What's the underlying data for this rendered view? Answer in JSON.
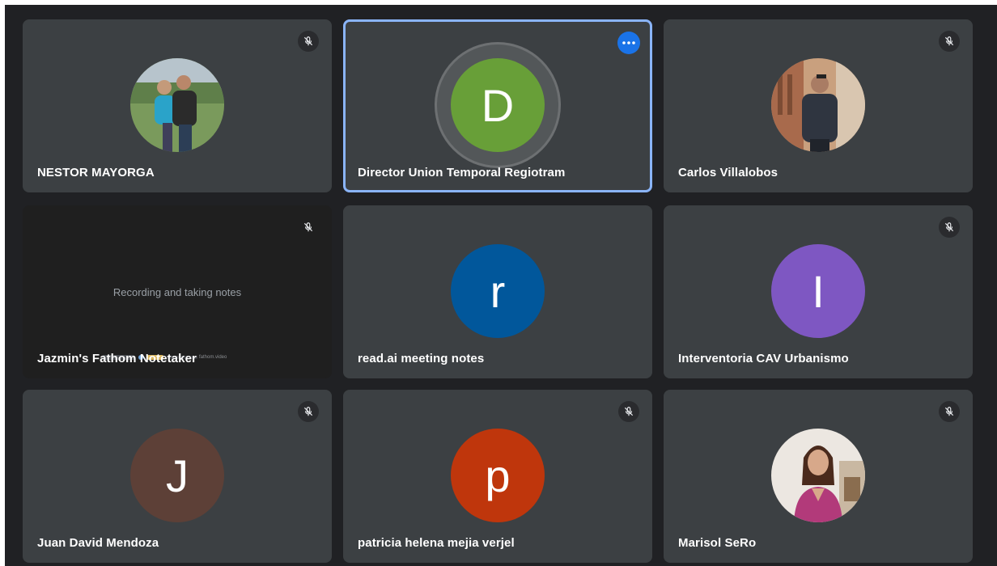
{
  "participants": [
    {
      "name": "NESTOR MAYORGA",
      "avatar": "photo",
      "muted": true
    },
    {
      "name": "Director Union Temporal Regiotram",
      "initial": "D",
      "color": "#689f38",
      "speaking": true
    },
    {
      "name": "Carlos Villalobos",
      "avatar": "photo",
      "muted": true
    },
    {
      "name": "Jazmin's Fathom Notetaker",
      "muted": true,
      "screen_text": "Recording and taking notes",
      "screen_small_text": "fathom.video"
    },
    {
      "name": "read.ai meeting notes",
      "initial": "r",
      "color": "#01579b"
    },
    {
      "name": "Interventoria CAV Urbanismo",
      "initial": "I",
      "color": "#7e57c2",
      "muted": true
    },
    {
      "name": "Juan David Mendoza",
      "initial": "J",
      "color": "#5d4037",
      "muted": true
    },
    {
      "name": "patricia helena mejia verjel",
      "initial": "p",
      "color": "#bf360c",
      "muted": true
    },
    {
      "name": "Marisol SeRo",
      "avatar": "photo",
      "muted": true
    }
  ],
  "icons": {
    "mute": "mic-off-icon",
    "more": "more-options-icon"
  }
}
